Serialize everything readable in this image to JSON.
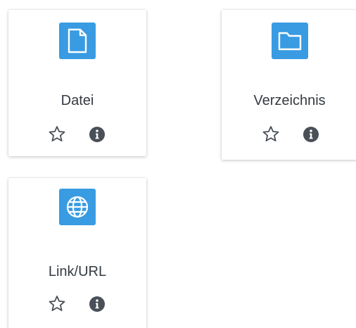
{
  "colors": {
    "icon_background": "#399be2",
    "icon_foreground": "#ffffff",
    "text": "#343a40",
    "action_icon": "#495057",
    "card_background": "#ffffff"
  },
  "activities": [
    {
      "name": "Datei",
      "icon": "file-icon"
    },
    {
      "name": "Verzeichnis",
      "icon": "folder-icon"
    },
    {
      "name": "Link/URL",
      "icon": "globe-icon"
    }
  ],
  "actions": {
    "star_icon": "star-outline-icon",
    "info_icon": "info-circle-icon"
  }
}
